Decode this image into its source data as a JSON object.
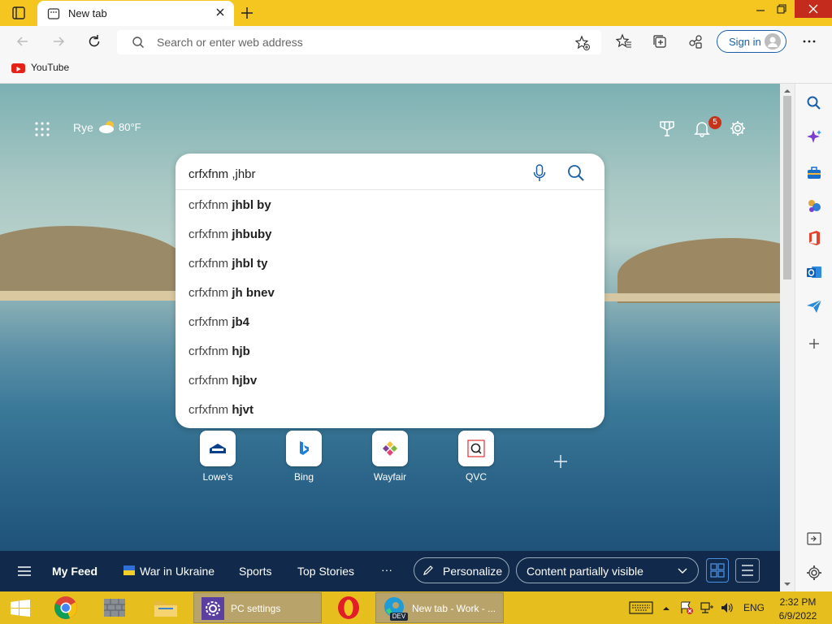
{
  "window": {
    "tab_title": "New tab",
    "new_tab_symbol": "+"
  },
  "address_bar": {
    "placeholder": "Search or enter web address",
    "sign_in_label": "Sign in"
  },
  "favorites": [
    {
      "label": "YouTube",
      "icon": "youtube-icon"
    }
  ],
  "new_tab_page": {
    "weather": {
      "location": "Rye",
      "temperature": "80°F"
    },
    "notification_count": "5",
    "search": {
      "query": "crfxfnm ,jhbr",
      "suggestions": [
        {
          "prefix": "crfxfnm ",
          "bold": "jhbl by"
        },
        {
          "prefix": "crfxfnm ",
          "bold": "jhbuby"
        },
        {
          "prefix": "crfxfnm ",
          "bold": "jhbl ty"
        },
        {
          "prefix": "crfxfnm ",
          "bold": "jh bnev"
        },
        {
          "prefix": "crfxfnm ",
          "bold": "jb4"
        },
        {
          "prefix": "crfxfnm ",
          "bold": "hjb"
        },
        {
          "prefix": "crfxfnm ",
          "bold": "hjbv"
        },
        {
          "prefix": "crfxfnm ",
          "bold": "hjvt"
        }
      ]
    },
    "quick_links": [
      {
        "label": "Lowe's",
        "icon": "lowes-logo"
      },
      {
        "label": "Bing",
        "icon": "bing-logo"
      },
      {
        "label": "Wayfair",
        "icon": "wayfair-logo"
      },
      {
        "label": "QVC",
        "icon": "qvc-logo"
      }
    ],
    "feed_bar": {
      "my_feed": "My Feed",
      "war_in_ukraine": "War in Ukraine",
      "sports": "Sports",
      "top_stories": "Top Stories",
      "more": "···",
      "personalize": "Personalize",
      "content_visibility": "Content partially visible"
    }
  },
  "taskbar": {
    "pc_settings": "PC settings",
    "edge_window": "New tab - Work - ...",
    "edge_badge": "DEV",
    "language": "ENG",
    "time": "2:32 PM",
    "date": "6/9/2022"
  },
  "colors": {
    "title_bar": "#f5c520",
    "taskbar": "#e6bf1e",
    "feed_bar": "#11294a",
    "accent": "#1b5fa8"
  }
}
